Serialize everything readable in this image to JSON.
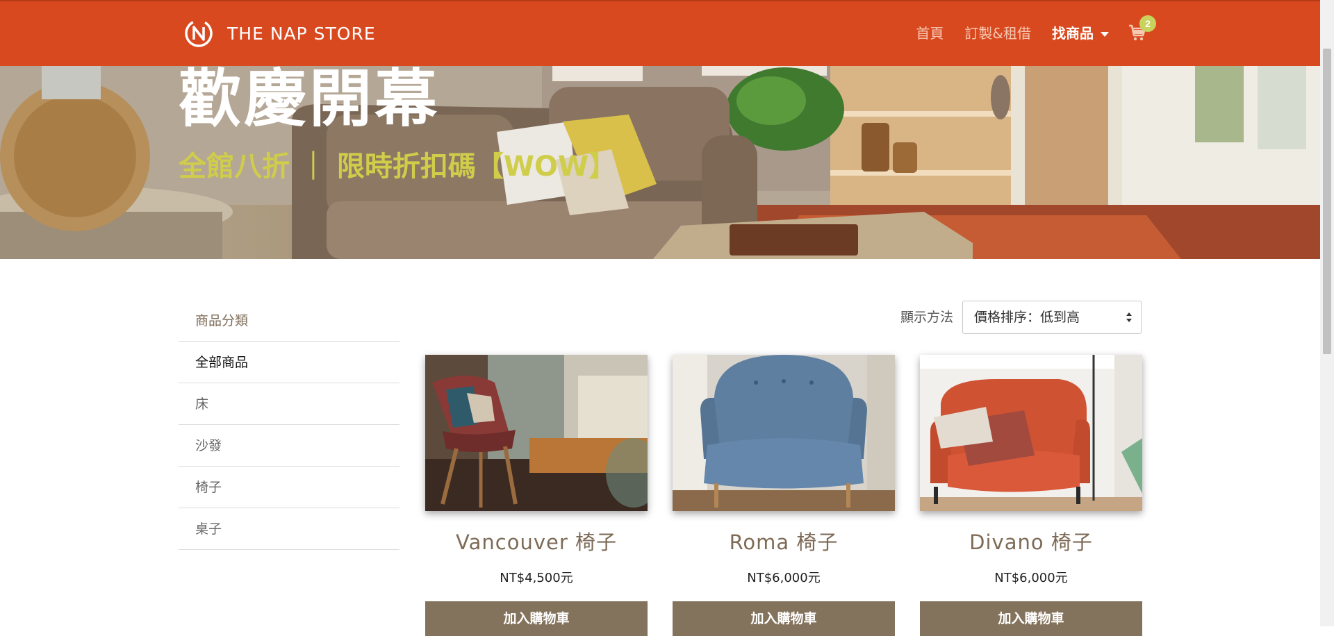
{
  "navbar": {
    "brand_name": "THE NAP STORE",
    "links": [
      {
        "label": "首頁"
      },
      {
        "label": "訂製&租借"
      },
      {
        "label": "找商品"
      }
    ],
    "cart_count": "2",
    "colors": {
      "background": "#d9491f",
      "badge": "#c7d35c"
    }
  },
  "hero": {
    "title": "歡慶開幕",
    "subtitle": "全館八折 ｜ 限時折扣碼【WOW】"
  },
  "sidebar": {
    "header": "商品分類",
    "items": [
      {
        "label": "全部商品"
      },
      {
        "label": "床"
      },
      {
        "label": "沙發"
      },
      {
        "label": "椅子"
      },
      {
        "label": "桌子"
      }
    ]
  },
  "sort": {
    "label": "顯示方法",
    "selected": "價格排序：低到高"
  },
  "products": [
    {
      "name": "Vancouver 椅子",
      "price": "NT$4,500元",
      "button": "加入購物車"
    },
    {
      "name": "Roma 椅子",
      "price": "NT$6,000元",
      "button": "加入購物車"
    },
    {
      "name": "Divano 椅子",
      "price": "NT$6,000元",
      "button": "加入購物車"
    }
  ],
  "theme": {
    "accent": "#84735c",
    "brand": "#d9491f"
  }
}
